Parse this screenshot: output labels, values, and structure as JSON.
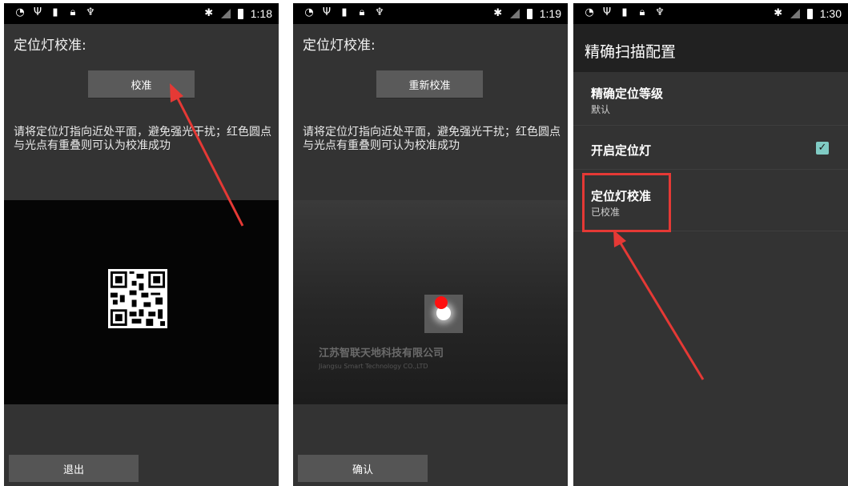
{
  "screens": [
    {
      "status_time": "1:18",
      "title": "定位灯校准:",
      "top_button": "校准",
      "hint": "请将定位灯指向近处平面，避免强光干扰；红色圆点与光点有重叠则可认为校准成功",
      "bottom_button": "退出"
    },
    {
      "status_time": "1:19",
      "title": "定位灯校准:",
      "top_button": "重新校准",
      "hint": "请将定位灯指向近处平面，避免强光干扰；红色圆点与光点有重叠则可认为校准成功",
      "bottom_button": "确认",
      "camera_text": "江苏智联天地科技有限公司",
      "camera_subtext": "Jiangsu Smart Technology CO.,LTD"
    },
    {
      "status_time": "1:30",
      "appbar_title": "精确扫描配置",
      "prefs": [
        {
          "title": "精确定位等级",
          "summary": "默认"
        },
        {
          "title": "开启定位灯",
          "checked": true
        },
        {
          "title": "定位灯校准",
          "summary": "已校准"
        }
      ]
    }
  ],
  "colors": {
    "arrow": "#e53935",
    "checkbox": "#80cbc4",
    "background": "#333333"
  },
  "icons": [
    "wifi-icon",
    "usb-icon",
    "sim-icon",
    "lock-icon",
    "android-icon",
    "bluetooth-icon",
    "signal-icon",
    "battery-icon"
  ]
}
